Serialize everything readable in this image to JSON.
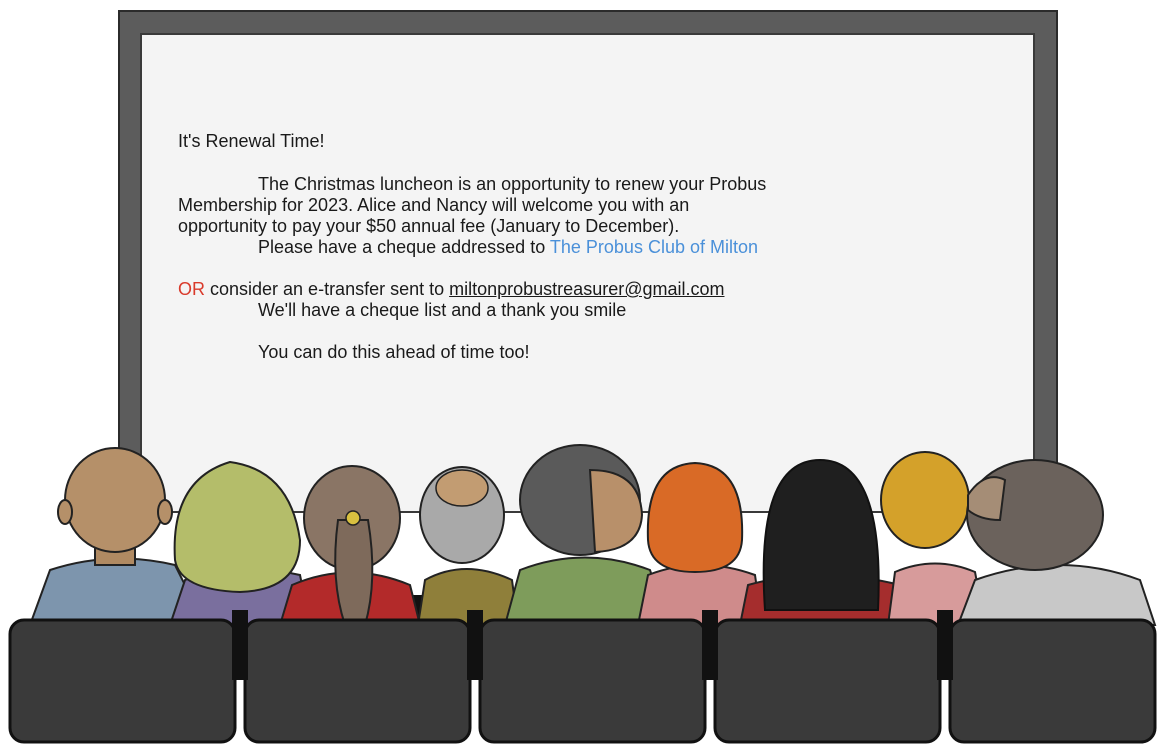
{
  "notice": {
    "heading": "It's Renewal Time!",
    "line1": "The Christmas luncheon is an opportunity to renew your Probus",
    "line2": "Membership for 2023. Alice and Nancy will welcome you with an",
    "line3": "opportunity to pay your $50 annual fee (January to December).",
    "cheque_prefix": "Please have a cheque addressed to ",
    "club_name": "The Probus Club of Milton",
    "or_word": "OR",
    "etransfer_text": " consider an e-transfer sent to ",
    "email": "miltonprobustreasurer@gmail.com",
    "cheque_list": "We'll have a cheque list and a thank you smile",
    "ahead": "You can do this ahead of time too!"
  },
  "colors": {
    "frame": "#5c5c5c",
    "screen": "#f4f4f4",
    "club_name": "#4a90d9",
    "or_word": "#d93a2b",
    "seats": "#3a3a3a"
  }
}
